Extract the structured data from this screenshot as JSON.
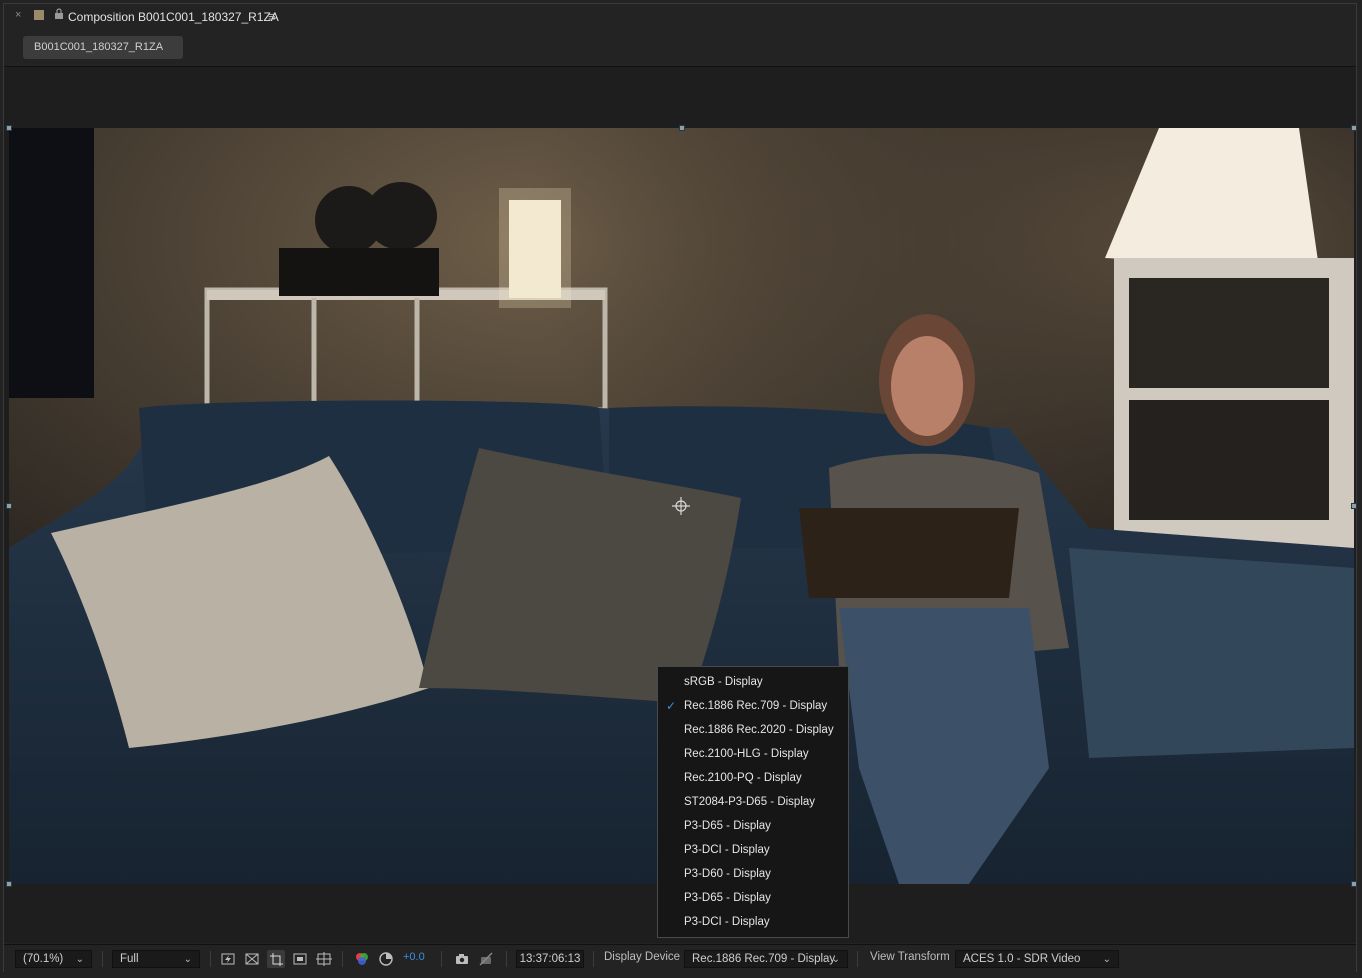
{
  "titlebar": {
    "close": "×",
    "menu": "≡",
    "title": "Composition B001C001_180327_R1ZA"
  },
  "tabs": [
    {
      "label": "B001C001_180327_R1ZA"
    }
  ],
  "dropdown": {
    "selected_index": 1,
    "check": "✓",
    "items": [
      "sRGB - Display",
      "Rec.1886 Rec.709 - Display",
      "Rec.1886 Rec.2020 - Display",
      "Rec.2100-HLG - Display",
      "Rec.2100-PQ - Display",
      "ST2084-P3-D65 - Display",
      "P3-D65 - Display",
      "P3-DCI - Display",
      "P3-D60 - Display",
      "P3-D65 - Display",
      "P3-DCI - Display"
    ]
  },
  "toolbar": {
    "zoom": "(70.1%)",
    "resolution": "Full",
    "exposure": "+0.0",
    "timecode": "13:37:06:13",
    "display_device_label": "Display Device",
    "display_device_value": "Rec.1886 Rec.709 - Display",
    "view_transform_label": "View Transform",
    "view_transform_value": "ACES 1.0 - SDR Video",
    "chevron": "⌄"
  },
  "colors": {
    "accent": "#3b8fe0",
    "panel": "#232323",
    "label_swatch": "#9a8a6a"
  }
}
